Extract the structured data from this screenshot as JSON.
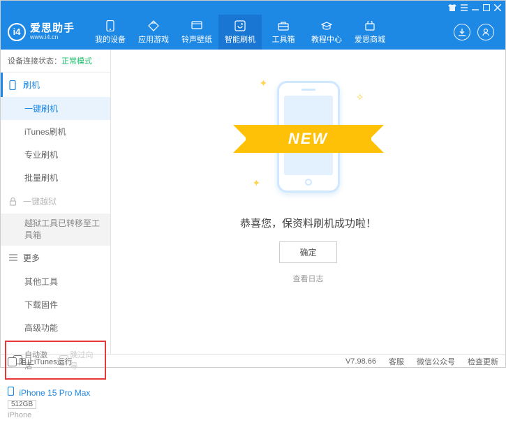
{
  "app": {
    "title": "爱思助手",
    "url": "www.i4.cn"
  },
  "titlebar": {
    "tshirt": "▾"
  },
  "nav": [
    {
      "label": "我的设备"
    },
    {
      "label": "应用游戏"
    },
    {
      "label": "铃声壁纸"
    },
    {
      "label": "智能刷机"
    },
    {
      "label": "工具箱"
    },
    {
      "label": "教程中心"
    },
    {
      "label": "爱思商城"
    }
  ],
  "status": {
    "label": "设备连接状态：",
    "value": "正常模式"
  },
  "sidebar": {
    "flash": {
      "header": "刷机",
      "items": [
        "一键刷机",
        "iTunes刷机",
        "专业刷机",
        "批量刷机"
      ]
    },
    "jailbreak": {
      "header": "一键越狱",
      "info": "越狱工具已转移至工具箱"
    },
    "more": {
      "header": "更多",
      "items": [
        "其他工具",
        "下载固件",
        "高级功能"
      ]
    }
  },
  "checks": {
    "auto_activate": "自动激活",
    "skip_wizard": "跳过向导"
  },
  "device": {
    "name": "iPhone 15 Pro Max",
    "storage": "512GB",
    "type": "iPhone"
  },
  "main": {
    "new": "NEW",
    "success": "恭喜您，保资料刷机成功啦！",
    "ok": "确定",
    "log": "查看日志"
  },
  "footer": {
    "block": "阻止iTunes运行",
    "version": "V7.98.66",
    "service": "客服",
    "wechat": "微信公众号",
    "update": "检查更新"
  }
}
